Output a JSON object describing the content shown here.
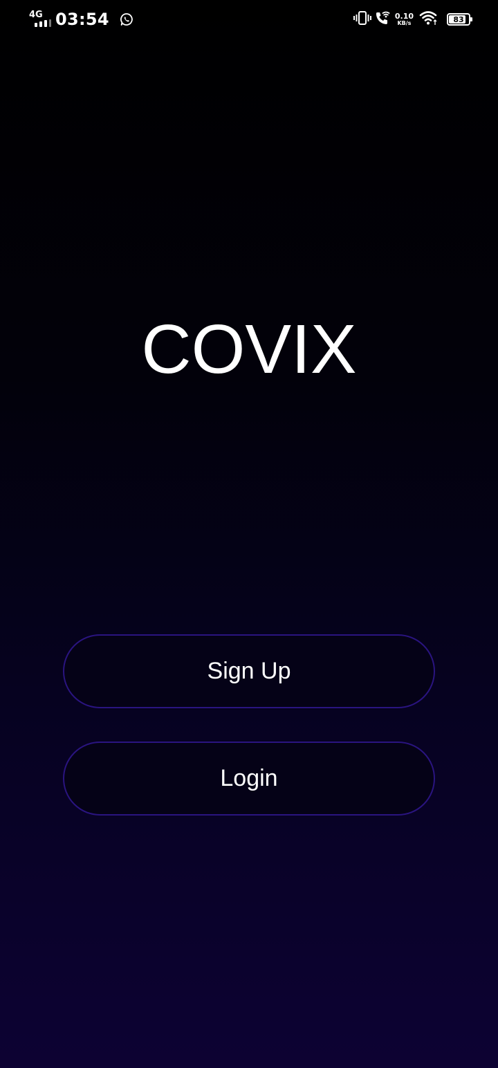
{
  "status_bar": {
    "network_type": "4G",
    "time": "03:54",
    "net_speed_value": "0.10",
    "net_speed_unit": "KB/s",
    "battery_level": "83",
    "icons": [
      "signal-icon",
      "whatsapp-icon",
      "vibrate-icon",
      "wifi-calling-icon",
      "wifi-icon",
      "battery-icon"
    ]
  },
  "app": {
    "title": "COVIX"
  },
  "buttons": {
    "signup_label": "Sign Up",
    "login_label": "Login"
  },
  "colors": {
    "background_top": "#000000",
    "background_bottom": "#0d0233",
    "button_border": "#2a1480",
    "text": "#ffffff"
  }
}
